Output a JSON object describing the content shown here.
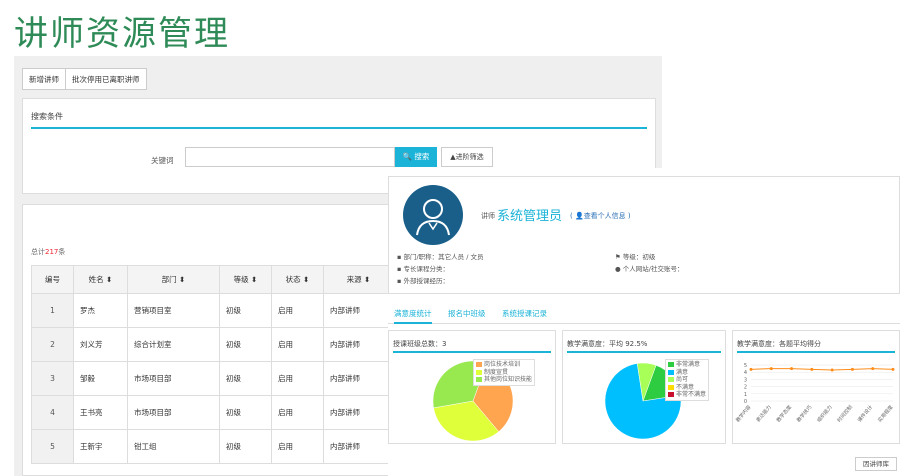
{
  "page": {
    "title": "讲师资源管理"
  },
  "toolbar": {
    "add_label": "新增讲师",
    "batch_label": "批次停用已离职讲师"
  },
  "search": {
    "title": "搜索条件",
    "keyword_label": "关键词",
    "keyword_value": "",
    "search_label": "搜索",
    "advanced_label": "▲进阶筛选"
  },
  "list": {
    "total_prefix": "总计",
    "total_count": "217",
    "total_suffix": "条",
    "headers": [
      "编号",
      "姓名",
      "部门",
      "等级",
      "状态",
      "来源"
    ],
    "rows": [
      {
        "id": "1",
        "name": "罗杰",
        "dept": "营销项目室",
        "level": "初级",
        "status": "启用",
        "source": "内部讲师"
      },
      {
        "id": "2",
        "name": "刘义芳",
        "dept": "综合计划室",
        "level": "初级",
        "status": "启用",
        "source": "内部讲师"
      },
      {
        "id": "3",
        "name": "邹毅",
        "dept": "市场项目部",
        "level": "初级",
        "status": "启用",
        "source": "内部讲师"
      },
      {
        "id": "4",
        "name": "王书亮",
        "dept": "市场项目部",
        "level": "初级",
        "status": "启用",
        "source": "内部讲师"
      },
      {
        "id": "5",
        "name": "王新宇",
        "dept": "钳工组",
        "level": "初级",
        "status": "启用",
        "source": "内部讲师"
      }
    ]
  },
  "profile": {
    "role_prefix": "讲师",
    "name": "系统管理员",
    "view_link": "查看个人信息",
    "dept_line": "部门/职称：其它人员 / 文员",
    "course_line": "专长课程分类：",
    "external_line": "外部授课经历：",
    "level_line": "等级：初级",
    "site_line": "个人网站/社交账号："
  },
  "tabs": [
    "满意度统计",
    "报名中班级",
    "系统授课记录"
  ],
  "cards": {
    "classes": {
      "title": "授课班级总数：3"
    },
    "satisfaction": {
      "title": "教学满意度：平均 92.5%"
    },
    "average": {
      "title": "教学满意度：各题平均得分"
    }
  },
  "close_label": "因讲师库",
  "chart_data": [
    {
      "type": "pie",
      "title": "授课班级总数：3",
      "categories": [
        "岗位技术培训",
        "制度宣贯",
        "其他岗位知识技能"
      ],
      "values": [
        1,
        1,
        1
      ],
      "colors": [
        "#ffa54f",
        "#dfff3a",
        "#98e84f"
      ]
    },
    {
      "type": "pie",
      "title": "教学满意度：平均 92.5%",
      "categories": [
        "非常满意",
        "满意",
        "尚可",
        "不满意",
        "非常不满意"
      ],
      "values": [
        17,
        75,
        8,
        0,
        0
      ],
      "colors": [
        "#2ecc40",
        "#00bfff",
        "#a8ff57",
        "#ffdc00",
        "#c8102e"
      ]
    },
    {
      "type": "line",
      "title": "教学满意度：各题平均得分",
      "categories": [
        "教学内容",
        "表达能力",
        "教学态度",
        "教学技巧",
        "组织能力",
        "时间控制",
        "课件设计",
        "实用程度"
      ],
      "values": [
        4.4,
        4.5,
        4.5,
        4.4,
        4.3,
        4.4,
        4.5,
        4.4
      ],
      "ylim": [
        0,
        5
      ],
      "yticks": [
        "5",
        "4",
        "3",
        "2",
        "1",
        "0"
      ],
      "color": "#ff8c1a"
    }
  ]
}
